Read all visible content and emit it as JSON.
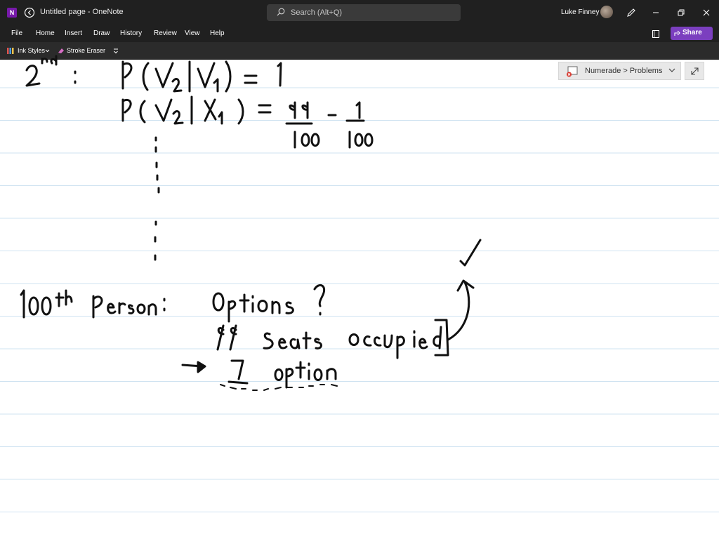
{
  "window": {
    "title": "Untitled page  -  OneNote",
    "app_icon_letter": "N"
  },
  "search": {
    "placeholder": "Search (Alt+Q)"
  },
  "user": {
    "name": "Luke Finney"
  },
  "menu": {
    "items": [
      "File",
      "Home",
      "Insert",
      "Draw",
      "History",
      "Review",
      "View",
      "Help"
    ],
    "share_label": "Share"
  },
  "toolbar": {
    "ink_styles_label": "Ink Styles",
    "stroke_eraser_label": "Stroke Eraser"
  },
  "addin": {
    "label": "Numerade > Problems"
  },
  "colors": {
    "titlebar_bg": "#202020",
    "accent_purple": "#7b3fbf",
    "rule_line": "#cfe3f1"
  },
  "ink_notes": {
    "line1": "2nd :  P( V2 | V1 ) = 1",
    "line2": "P( V2 | X1 ) = 99/100 - 1/100",
    "line3": "100th Person :  Options ?",
    "line4": "99 Seats occupied",
    "line5": "1 option"
  }
}
